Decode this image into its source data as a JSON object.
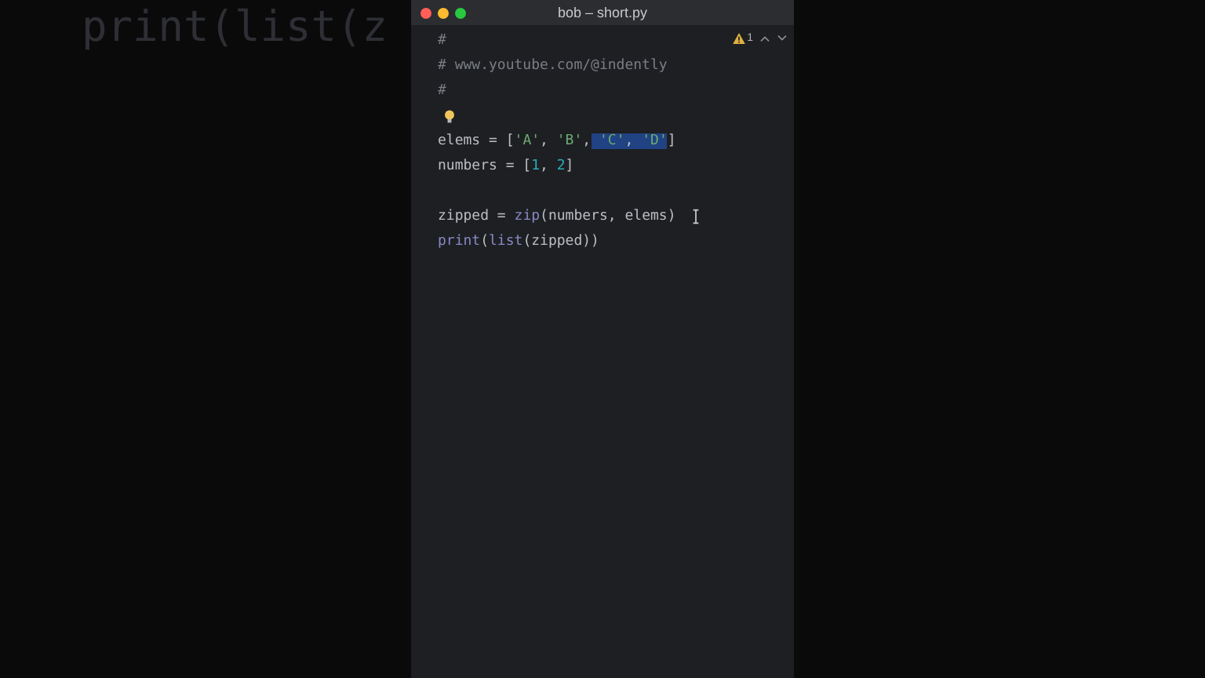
{
  "backdrop_text": "print(list(z",
  "window": {
    "title": "bob – short.py"
  },
  "inspection": {
    "warnings": "1"
  },
  "lines": [
    {
      "kind": "code",
      "tokens": [
        {
          "text": "#",
          "kind": "comment",
          "selected": false
        }
      ]
    },
    {
      "kind": "code",
      "tokens": [
        {
          "text": "# www.youtube.com/@indently",
          "kind": "comment",
          "selected": false
        }
      ]
    },
    {
      "kind": "code",
      "tokens": [
        {
          "text": "#",
          "kind": "comment",
          "selected": false
        }
      ]
    },
    {
      "kind": "bulb"
    },
    {
      "kind": "code",
      "tokens": [
        {
          "text": "elems = [",
          "kind": "plain",
          "selected": false
        },
        {
          "text": "'A'",
          "kind": "string",
          "selected": false
        },
        {
          "text": ", ",
          "kind": "plain",
          "selected": false
        },
        {
          "text": "'B'",
          "kind": "string",
          "selected": false
        },
        {
          "text": ",",
          "kind": "plain",
          "selected": false
        },
        {
          "text": " 'C'",
          "kind": "string",
          "selected": true
        },
        {
          "text": ", ",
          "kind": "plain",
          "selected": true
        },
        {
          "text": "'D'",
          "kind": "string",
          "selected": true
        },
        {
          "text": "]",
          "kind": "plain",
          "selected": false
        }
      ]
    },
    {
      "kind": "code",
      "tokens": [
        {
          "text": "numbers = [",
          "kind": "plain",
          "selected": false
        },
        {
          "text": "1",
          "kind": "number",
          "selected": false
        },
        {
          "text": ", ",
          "kind": "plain",
          "selected": false
        },
        {
          "text": "2",
          "kind": "number",
          "selected": false
        },
        {
          "text": "]",
          "kind": "plain",
          "selected": false
        }
      ]
    },
    {
      "kind": "blank"
    },
    {
      "kind": "code",
      "tokens": [
        {
          "text": "zipped = ",
          "kind": "plain",
          "selected": false
        },
        {
          "text": "zip",
          "kind": "builtin",
          "selected": false
        },
        {
          "text": "(numbers, elems)",
          "kind": "plain",
          "selected": false
        }
      ],
      "mouse_cursor": true
    },
    {
      "kind": "code",
      "tokens": [
        {
          "text": "print",
          "kind": "builtin",
          "selected": false
        },
        {
          "text": "(",
          "kind": "plain",
          "selected": false
        },
        {
          "text": "list",
          "kind": "builtin",
          "selected": false
        },
        {
          "text": "(zipped))",
          "kind": "plain",
          "selected": false
        }
      ]
    }
  ]
}
